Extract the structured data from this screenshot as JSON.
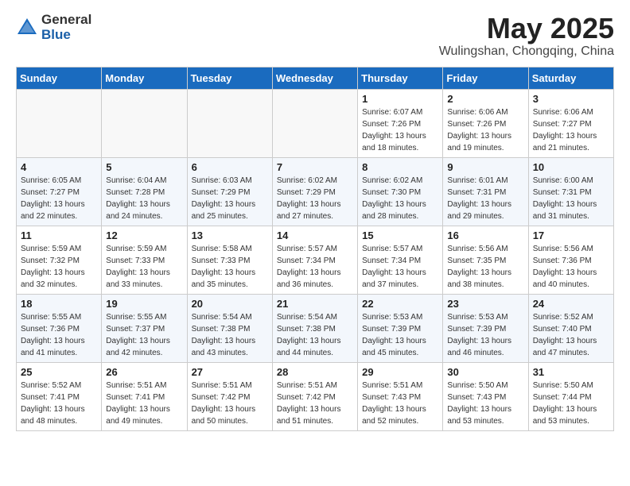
{
  "logo": {
    "general": "General",
    "blue": "Blue"
  },
  "title": "May 2025",
  "location": "Wulingshan, Chongqing, China",
  "days_of_week": [
    "Sunday",
    "Monday",
    "Tuesday",
    "Wednesday",
    "Thursday",
    "Friday",
    "Saturday"
  ],
  "weeks": [
    [
      {
        "day": "",
        "info": ""
      },
      {
        "day": "",
        "info": ""
      },
      {
        "day": "",
        "info": ""
      },
      {
        "day": "",
        "info": ""
      },
      {
        "day": "1",
        "info": "Sunrise: 6:07 AM\nSunset: 7:26 PM\nDaylight: 13 hours\nand 18 minutes."
      },
      {
        "day": "2",
        "info": "Sunrise: 6:06 AM\nSunset: 7:26 PM\nDaylight: 13 hours\nand 19 minutes."
      },
      {
        "day": "3",
        "info": "Sunrise: 6:06 AM\nSunset: 7:27 PM\nDaylight: 13 hours\nand 21 minutes."
      }
    ],
    [
      {
        "day": "4",
        "info": "Sunrise: 6:05 AM\nSunset: 7:27 PM\nDaylight: 13 hours\nand 22 minutes."
      },
      {
        "day": "5",
        "info": "Sunrise: 6:04 AM\nSunset: 7:28 PM\nDaylight: 13 hours\nand 24 minutes."
      },
      {
        "day": "6",
        "info": "Sunrise: 6:03 AM\nSunset: 7:29 PM\nDaylight: 13 hours\nand 25 minutes."
      },
      {
        "day": "7",
        "info": "Sunrise: 6:02 AM\nSunset: 7:29 PM\nDaylight: 13 hours\nand 27 minutes."
      },
      {
        "day": "8",
        "info": "Sunrise: 6:02 AM\nSunset: 7:30 PM\nDaylight: 13 hours\nand 28 minutes."
      },
      {
        "day": "9",
        "info": "Sunrise: 6:01 AM\nSunset: 7:31 PM\nDaylight: 13 hours\nand 29 minutes."
      },
      {
        "day": "10",
        "info": "Sunrise: 6:00 AM\nSunset: 7:31 PM\nDaylight: 13 hours\nand 31 minutes."
      }
    ],
    [
      {
        "day": "11",
        "info": "Sunrise: 5:59 AM\nSunset: 7:32 PM\nDaylight: 13 hours\nand 32 minutes."
      },
      {
        "day": "12",
        "info": "Sunrise: 5:59 AM\nSunset: 7:33 PM\nDaylight: 13 hours\nand 33 minutes."
      },
      {
        "day": "13",
        "info": "Sunrise: 5:58 AM\nSunset: 7:33 PM\nDaylight: 13 hours\nand 35 minutes."
      },
      {
        "day": "14",
        "info": "Sunrise: 5:57 AM\nSunset: 7:34 PM\nDaylight: 13 hours\nand 36 minutes."
      },
      {
        "day": "15",
        "info": "Sunrise: 5:57 AM\nSunset: 7:34 PM\nDaylight: 13 hours\nand 37 minutes."
      },
      {
        "day": "16",
        "info": "Sunrise: 5:56 AM\nSunset: 7:35 PM\nDaylight: 13 hours\nand 38 minutes."
      },
      {
        "day": "17",
        "info": "Sunrise: 5:56 AM\nSunset: 7:36 PM\nDaylight: 13 hours\nand 40 minutes."
      }
    ],
    [
      {
        "day": "18",
        "info": "Sunrise: 5:55 AM\nSunset: 7:36 PM\nDaylight: 13 hours\nand 41 minutes."
      },
      {
        "day": "19",
        "info": "Sunrise: 5:55 AM\nSunset: 7:37 PM\nDaylight: 13 hours\nand 42 minutes."
      },
      {
        "day": "20",
        "info": "Sunrise: 5:54 AM\nSunset: 7:38 PM\nDaylight: 13 hours\nand 43 minutes."
      },
      {
        "day": "21",
        "info": "Sunrise: 5:54 AM\nSunset: 7:38 PM\nDaylight: 13 hours\nand 44 minutes."
      },
      {
        "day": "22",
        "info": "Sunrise: 5:53 AM\nSunset: 7:39 PM\nDaylight: 13 hours\nand 45 minutes."
      },
      {
        "day": "23",
        "info": "Sunrise: 5:53 AM\nSunset: 7:39 PM\nDaylight: 13 hours\nand 46 minutes."
      },
      {
        "day": "24",
        "info": "Sunrise: 5:52 AM\nSunset: 7:40 PM\nDaylight: 13 hours\nand 47 minutes."
      }
    ],
    [
      {
        "day": "25",
        "info": "Sunrise: 5:52 AM\nSunset: 7:41 PM\nDaylight: 13 hours\nand 48 minutes."
      },
      {
        "day": "26",
        "info": "Sunrise: 5:51 AM\nSunset: 7:41 PM\nDaylight: 13 hours\nand 49 minutes."
      },
      {
        "day": "27",
        "info": "Sunrise: 5:51 AM\nSunset: 7:42 PM\nDaylight: 13 hours\nand 50 minutes."
      },
      {
        "day": "28",
        "info": "Sunrise: 5:51 AM\nSunset: 7:42 PM\nDaylight: 13 hours\nand 51 minutes."
      },
      {
        "day": "29",
        "info": "Sunrise: 5:51 AM\nSunset: 7:43 PM\nDaylight: 13 hours\nand 52 minutes."
      },
      {
        "day": "30",
        "info": "Sunrise: 5:50 AM\nSunset: 7:43 PM\nDaylight: 13 hours\nand 53 minutes."
      },
      {
        "day": "31",
        "info": "Sunrise: 5:50 AM\nSunset: 7:44 PM\nDaylight: 13 hours\nand 53 minutes."
      }
    ]
  ]
}
